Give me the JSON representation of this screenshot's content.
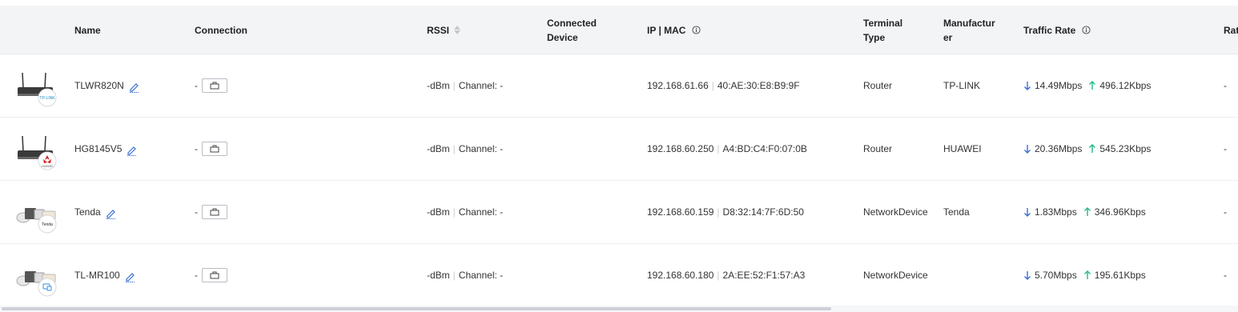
{
  "columns": {
    "name": "Name",
    "connection": "Connection",
    "rssi": "RSSI",
    "connected_device_1": "Connected",
    "connected_device_2": "Device",
    "ip_mac": "IP | MAC",
    "terminal_type_1": "Terminal",
    "terminal_type_2": "Type",
    "manufacturer_1": "Manufactur",
    "manufacturer_2": "er",
    "traffic_rate": "Traffic Rate",
    "rate_truncated": "Rat"
  },
  "rows": [
    {
      "icon": "router-tplink-icon",
      "name": "TLWR820N",
      "connection": "-",
      "rssi": "-dBm",
      "channel": "Channel: -",
      "ip": "192.168.61.66",
      "mac": "40:AE:30:E8:B9:9F",
      "terminal_type_1": "Router",
      "terminal_type_2": "",
      "manufacturer": "TP-LINK",
      "down": "14.49Mbps",
      "up": "496.12Kbps",
      "rate": "-"
    },
    {
      "icon": "router-huawei-icon",
      "name": "HG8145V5",
      "connection": "-",
      "rssi": "-dBm",
      "channel": "Channel: -",
      "ip": "192.168.60.250",
      "mac": "A4:BD:C4:F0:07:0B",
      "terminal_type_1": "Router",
      "terminal_type_2": "",
      "manufacturer": "HUAWEI",
      "down": "20.36Mbps",
      "up": "545.23Kbps",
      "rate": "-"
    },
    {
      "icon": "network-device-tenda-icon",
      "name": "Tenda",
      "connection": "-",
      "rssi": "-dBm",
      "channel": "Channel: -",
      "ip": "192.168.60.159",
      "mac": "D8:32:14:7F:6D:50",
      "terminal_type_1": "Network",
      "terminal_type_2": "Device",
      "manufacturer": "Tenda",
      "down": "1.83Mbps",
      "up": "346.96Kbps",
      "rate": "-"
    },
    {
      "icon": "network-device-generic-icon",
      "name": "TL-MR100",
      "connection": "-",
      "rssi": "-dBm",
      "channel": "Channel: -",
      "ip": "192.168.60.180",
      "mac": "2A:EE:52:F1:57:A3",
      "terminal_type_1": "Network",
      "terminal_type_2": "Device",
      "manufacturer": "",
      "down": "5.70Mbps",
      "up": "195.61Kbps",
      "rate": "-"
    }
  ],
  "colors": {
    "header_bg": "#f3f4f6",
    "down_arrow": "#3b6fd4",
    "up_arrow": "#1fb98a",
    "edit_icon": "#3b6fd4"
  }
}
